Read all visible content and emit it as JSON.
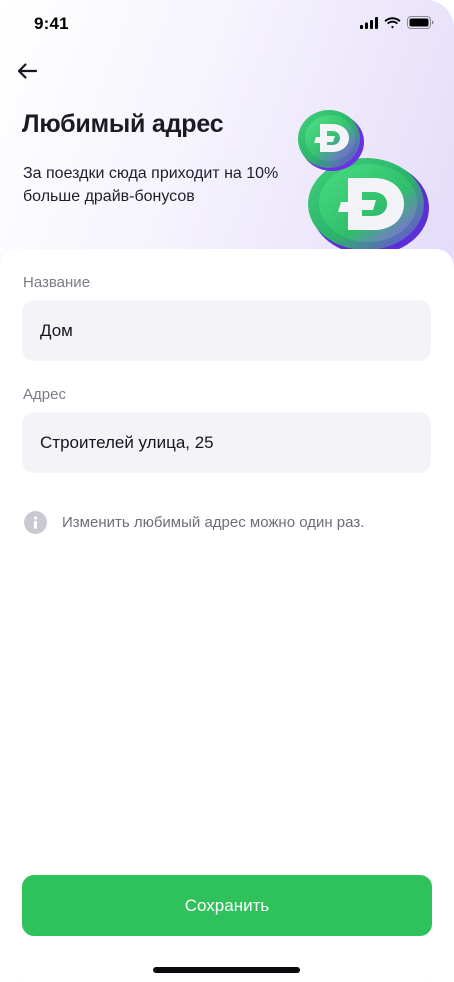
{
  "status_bar": {
    "time": "9:41",
    "icons": [
      "signal-icon",
      "wifi-icon",
      "battery-icon"
    ]
  },
  "header": {
    "back_icon": "arrow-left-icon",
    "title": "Любимый адрес",
    "subtitle": "За поездки сюда приходит на 10% больше драйв-бонусов",
    "illustration": "drive-bonus-coins"
  },
  "form": {
    "name_field": {
      "label": "Название",
      "value": "Дом"
    },
    "address_field": {
      "label": "Адрес",
      "value": "Строителей улица, 25"
    }
  },
  "info": {
    "icon": "info-icon",
    "text": "Изменить любимый адрес можно один раз."
  },
  "actions": {
    "save_label": "Сохранить"
  },
  "colors": {
    "accent_green": "#2fc25c",
    "field_background": "#f3f3f8",
    "label_gray": "#7b7b88"
  }
}
